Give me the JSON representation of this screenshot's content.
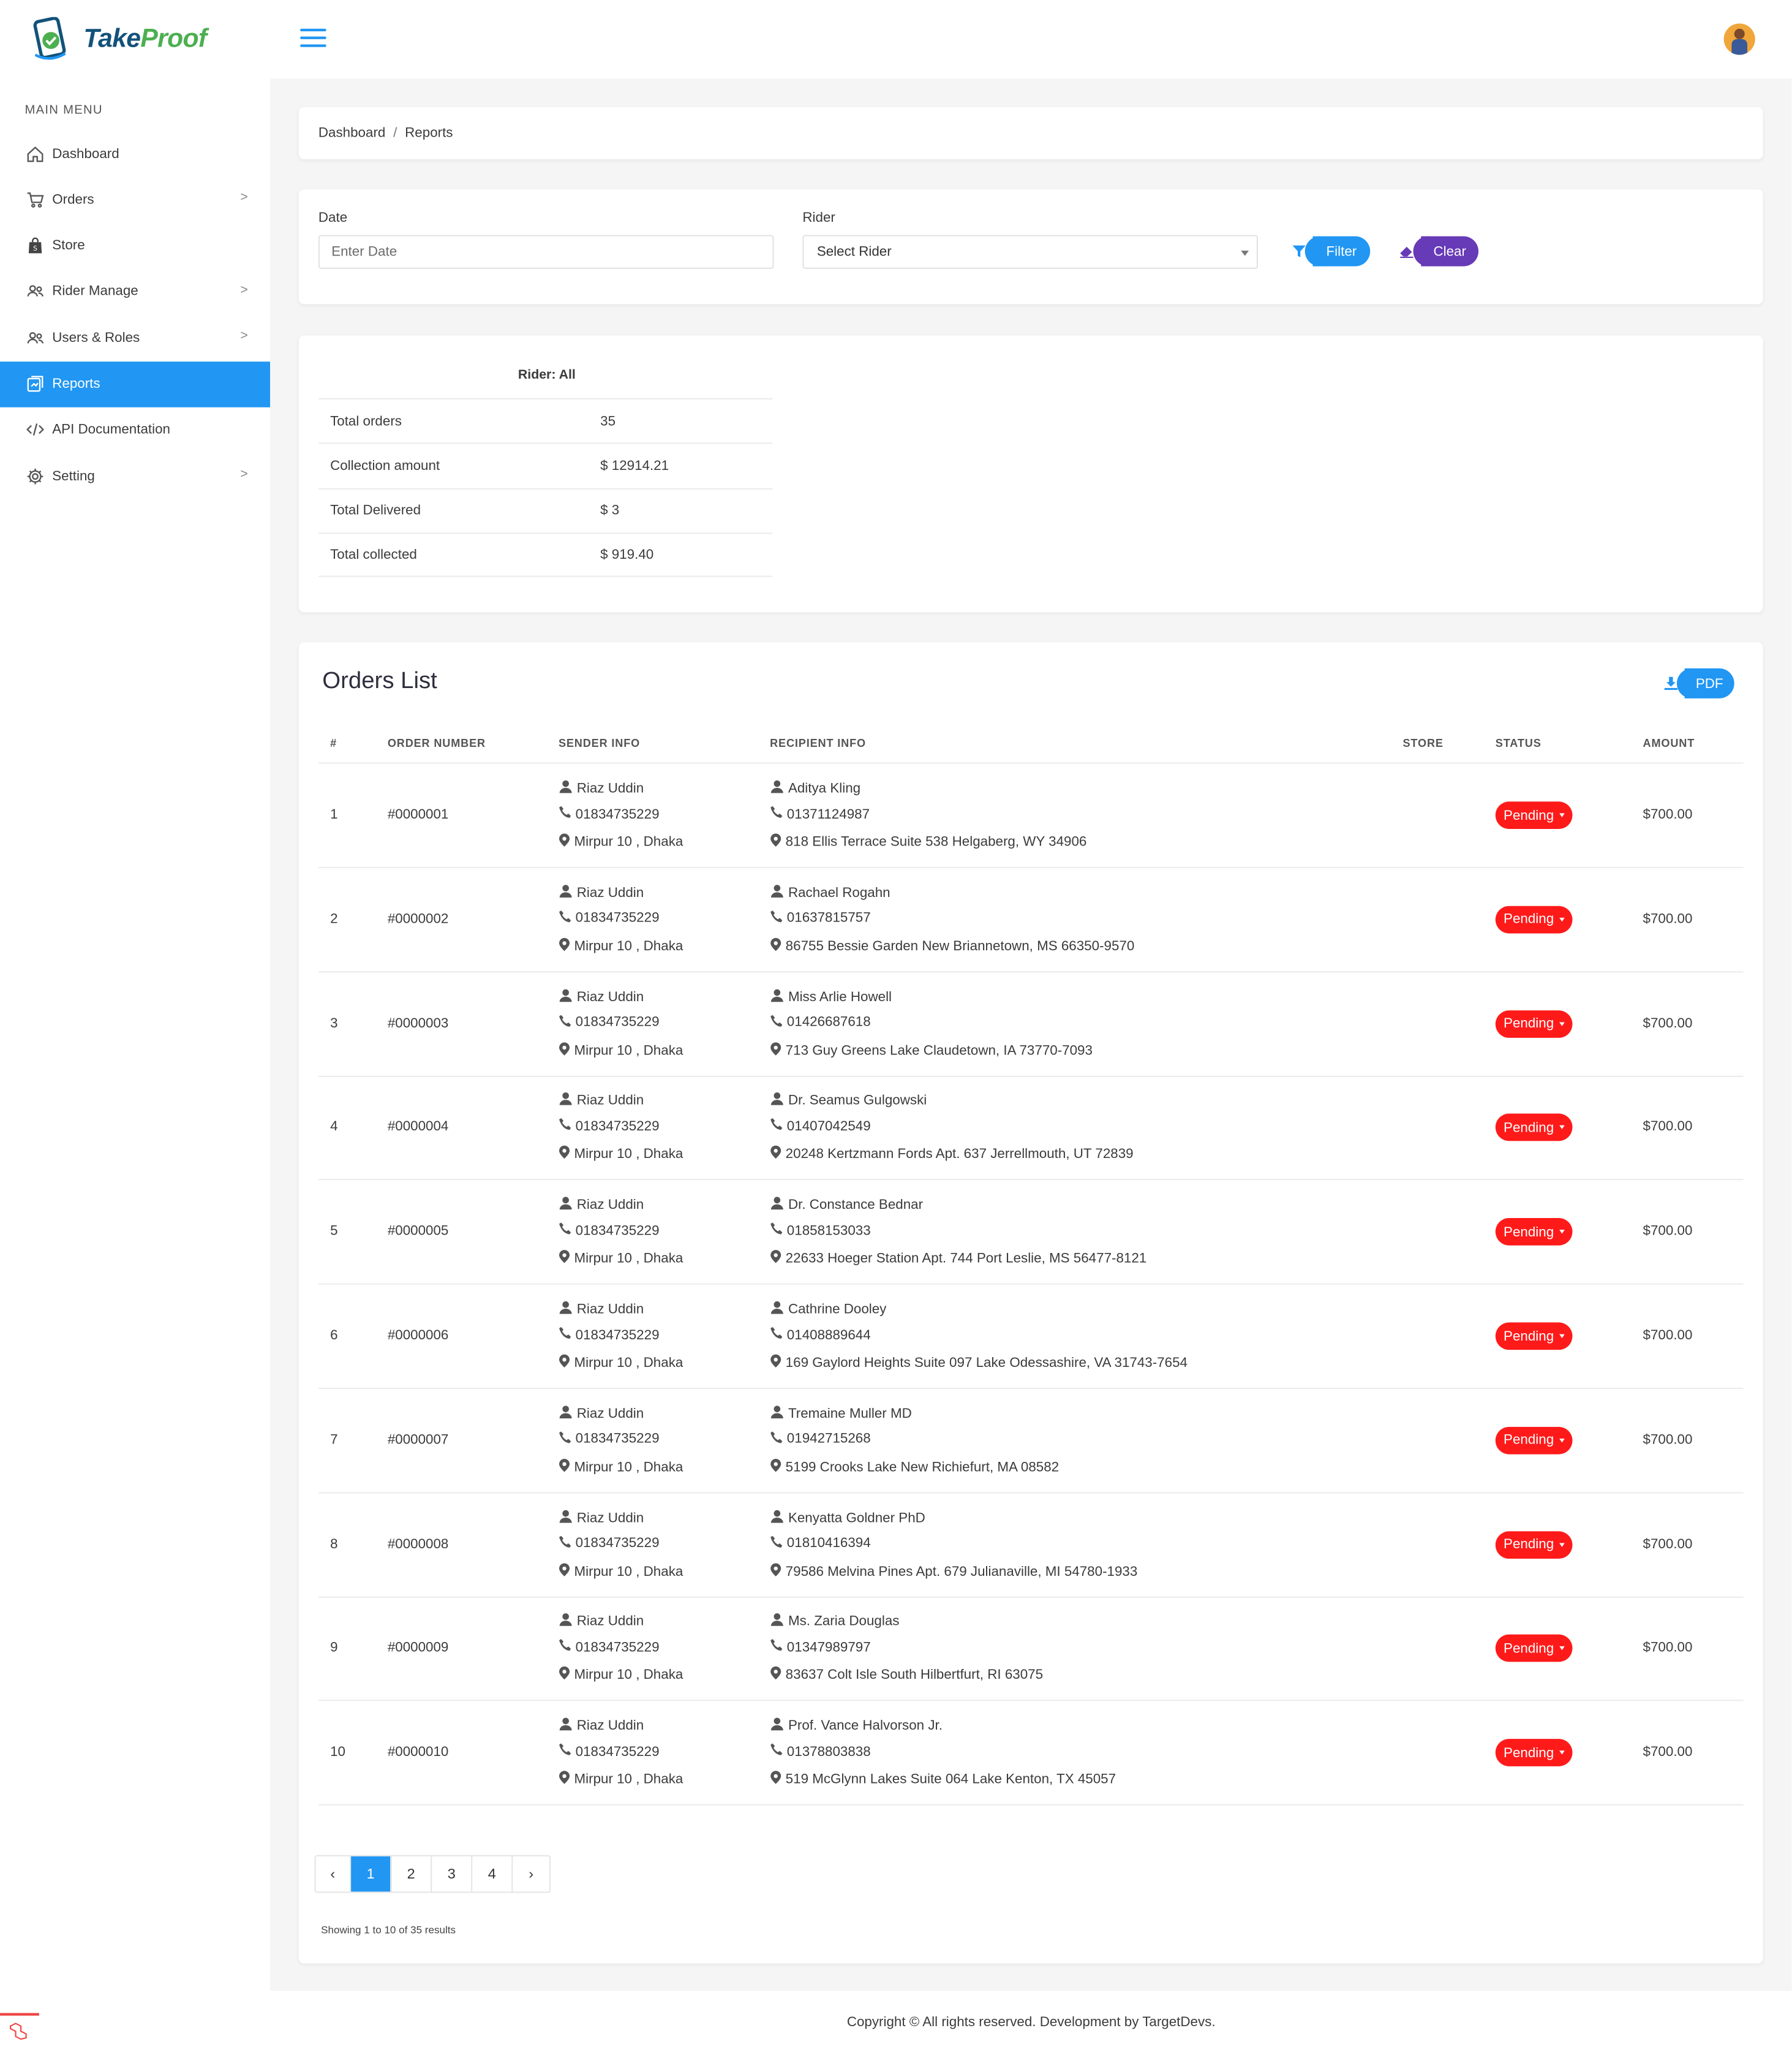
{
  "brand": {
    "part1": "Take",
    "part2": "Proof"
  },
  "sidebar": {
    "menu_title": "MAIN MENU",
    "items": [
      {
        "label": "Dashboard",
        "icon": "home-icon",
        "has_chevron": false
      },
      {
        "label": "Orders",
        "icon": "cart-icon",
        "has_chevron": true
      },
      {
        "label": "Store",
        "icon": "shopping-bag-icon",
        "has_chevron": false
      },
      {
        "label": "Rider Manage",
        "icon": "users-icon",
        "has_chevron": true
      },
      {
        "label": "Users & Roles",
        "icon": "users-icon",
        "has_chevron": true
      },
      {
        "label": "Reports",
        "icon": "report-icon",
        "has_chevron": false,
        "active": true
      },
      {
        "label": "API Documentation",
        "icon": "code-icon",
        "has_chevron": false
      },
      {
        "label": "Setting",
        "icon": "gear-icon",
        "has_chevron": true
      }
    ]
  },
  "breadcrumb": {
    "root": "Dashboard",
    "sep": "/",
    "current": "Reports"
  },
  "filters": {
    "date_label": "Date",
    "date_placeholder": "Enter Date",
    "rider_label": "Rider",
    "rider_selected": "Select Rider",
    "filter_button": "Filter",
    "clear_button": "Clear"
  },
  "summary": {
    "heading": "Rider: All",
    "rows": [
      {
        "label": "Total orders",
        "value": "35"
      },
      {
        "label": "Collection amount",
        "value": "$ 12914.21"
      },
      {
        "label": "Total Delivered",
        "value": "$ 3"
      },
      {
        "label": "Total collected",
        "value": "$ 919.40"
      }
    ]
  },
  "orders": {
    "title": "Orders List",
    "pdf_button": "PDF",
    "columns": [
      "#",
      "ORDER NUMBER",
      "SENDER INFO",
      "RECIPIENT INFO",
      "STORE",
      "STATUS",
      "AMOUNT"
    ],
    "rows": [
      {
        "idx": "1",
        "order_number": "#0000001",
        "sender_name": "Riaz Uddin",
        "sender_phone": "01834735229",
        "sender_address": "Mirpur 10 , Dhaka",
        "recipient_name": "Aditya Kling",
        "recipient_phone": "01371124987",
        "recipient_address": "818 Ellis Terrace Suite 538 Helgaberg, WY 34906",
        "store": "",
        "status": "Pending",
        "amount": "$700.00"
      },
      {
        "idx": "2",
        "order_number": "#0000002",
        "sender_name": "Riaz Uddin",
        "sender_phone": "01834735229",
        "sender_address": "Mirpur 10 , Dhaka",
        "recipient_name": "Rachael Rogahn",
        "recipient_phone": "01637815757",
        "recipient_address": "86755 Bessie Garden New Briannetown, MS 66350-9570",
        "store": "",
        "status": "Pending",
        "amount": "$700.00"
      },
      {
        "idx": "3",
        "order_number": "#0000003",
        "sender_name": "Riaz Uddin",
        "sender_phone": "01834735229",
        "sender_address": "Mirpur 10 , Dhaka",
        "recipient_name": "Miss Arlie Howell",
        "recipient_phone": "01426687618",
        "recipient_address": "713 Guy Greens Lake Claudetown, IA 73770-7093",
        "store": "",
        "status": "Pending",
        "amount": "$700.00"
      },
      {
        "idx": "4",
        "order_number": "#0000004",
        "sender_name": "Riaz Uddin",
        "sender_phone": "01834735229",
        "sender_address": "Mirpur 10 , Dhaka",
        "recipient_name": "Dr. Seamus Gulgowski",
        "recipient_phone": "01407042549",
        "recipient_address": "20248 Kertzmann Fords Apt. 637 Jerrellmouth, UT 72839",
        "store": "",
        "status": "Pending",
        "amount": "$700.00"
      },
      {
        "idx": "5",
        "order_number": "#0000005",
        "sender_name": "Riaz Uddin",
        "sender_phone": "01834735229",
        "sender_address": "Mirpur 10 , Dhaka",
        "recipient_name": "Dr. Constance Bednar",
        "recipient_phone": "01858153033",
        "recipient_address": "22633 Hoeger Station Apt. 744 Port Leslie, MS 56477-8121",
        "store": "",
        "status": "Pending",
        "amount": "$700.00"
      },
      {
        "idx": "6",
        "order_number": "#0000006",
        "sender_name": "Riaz Uddin",
        "sender_phone": "01834735229",
        "sender_address": "Mirpur 10 , Dhaka",
        "recipient_name": "Cathrine Dooley",
        "recipient_phone": "01408889644",
        "recipient_address": "169 Gaylord Heights Suite 097 Lake Odessashire, VA 31743-7654",
        "store": "",
        "status": "Pending",
        "amount": "$700.00"
      },
      {
        "idx": "7",
        "order_number": "#0000007",
        "sender_name": "Riaz Uddin",
        "sender_phone": "01834735229",
        "sender_address": "Mirpur 10 , Dhaka",
        "recipient_name": "Tremaine Muller MD",
        "recipient_phone": "01942715268",
        "recipient_address": "5199 Crooks Lake New Richiefurt, MA 08582",
        "store": "",
        "status": "Pending",
        "amount": "$700.00"
      },
      {
        "idx": "8",
        "order_number": "#0000008",
        "sender_name": "Riaz Uddin",
        "sender_phone": "01834735229",
        "sender_address": "Mirpur 10 , Dhaka",
        "recipient_name": "Kenyatta Goldner PhD",
        "recipient_phone": "01810416394",
        "recipient_address": "79586 Melvina Pines Apt. 679 Julianaville, MI 54780-1933",
        "store": "",
        "status": "Pending",
        "amount": "$700.00"
      },
      {
        "idx": "9",
        "order_number": "#0000009",
        "sender_name": "Riaz Uddin",
        "sender_phone": "01834735229",
        "sender_address": "Mirpur 10 , Dhaka",
        "recipient_name": "Ms. Zaria Douglas",
        "recipient_phone": "01347989797",
        "recipient_address": "83637 Colt Isle South Hilbertfurt, RI 63075",
        "store": "",
        "status": "Pending",
        "amount": "$700.00"
      },
      {
        "idx": "10",
        "order_number": "#0000010",
        "sender_name": "Riaz Uddin",
        "sender_phone": "01834735229",
        "sender_address": "Mirpur 10 , Dhaka",
        "recipient_name": "Prof. Vance Halvorson Jr.",
        "recipient_phone": "01378803838",
        "recipient_address": "519 McGlynn Lakes Suite 064 Lake Kenton, TX 45057",
        "store": "",
        "status": "Pending",
        "amount": "$700.00"
      }
    ]
  },
  "pagination": {
    "prev": "‹",
    "pages": [
      "1",
      "2",
      "3",
      "4"
    ],
    "current": "1",
    "next": "›",
    "summary": "Showing 1 to 10 of 35 results"
  },
  "footer": {
    "copyright": "Copyright © All rights reserved. Development by TargetDevs."
  },
  "colors": {
    "accent": "#2196f3",
    "clear": "#673ab7",
    "status_pending": "#ff1a1a"
  }
}
